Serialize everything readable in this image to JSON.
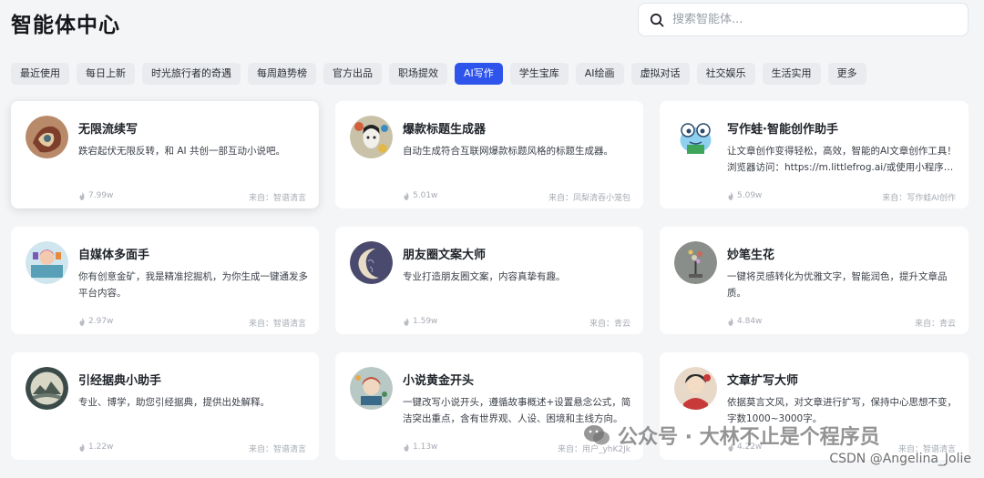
{
  "header": {
    "title": "智能体中心",
    "search_placeholder": "搜索智能体..."
  },
  "tabs": [
    {
      "label": "最近使用"
    },
    {
      "label": "每日上新"
    },
    {
      "label": "时光旅行者的奇遇"
    },
    {
      "label": "每周趋势榜"
    },
    {
      "label": "官方出品"
    },
    {
      "label": "职场提效"
    },
    {
      "label": "AI写作",
      "active": true
    },
    {
      "label": "学生宝库"
    },
    {
      "label": "AI绘画"
    },
    {
      "label": "虚拟对话"
    },
    {
      "label": "社交娱乐"
    },
    {
      "label": "生活实用"
    },
    {
      "label": "更多"
    }
  ],
  "cards": [
    {
      "title": "无限流续写",
      "desc": "跌宕起伏无限反转，和 AI 共创一部互动小说吧。",
      "heat": "7.99w",
      "source": "来自：智谱清言"
    },
    {
      "title": "爆款标题生成器",
      "desc": "自动生成符合互联网爆款标题风格的标题生成器。",
      "heat": "5.01w",
      "source": "来自：凤梨清吞小笼包"
    },
    {
      "title": "写作蛙·智能创作助手",
      "desc": "让文章创作变得轻松，高效，智能的AI文章创作工具！浏览器访问：https://m.littlefrog.ai/或使用小程序…",
      "heat": "5.09w",
      "source": "来自：写作蛙AI创作"
    },
    {
      "title": "自媒体多面手",
      "desc": "你有创意金矿，我是精准挖掘机，为你生成一键通发多平台内容。",
      "heat": "2.97w",
      "source": "来自：智谱清言"
    },
    {
      "title": "朋友圈文案大师",
      "desc": "专业打造朋友圈文案，内容真挚有趣。",
      "heat": "1.59w",
      "source": "来自：青云"
    },
    {
      "title": "妙笔生花",
      "desc": "一键将灵感转化为优雅文字，智能润色，提升文章品质。",
      "heat": "4.84w",
      "source": "来自：青云"
    },
    {
      "title": "引经据典小助手",
      "desc": "专业、博学，助您引经据典，提供出处解释。",
      "heat": "1.22w",
      "source": "来自：智谱清言"
    },
    {
      "title": "小说黄金开头",
      "desc": "一键改写小说开头，遵循故事概述+设置悬念公式，简洁突出重点，含有世界观、人设、困境和主线方向。",
      "heat": "1.13w",
      "source": "来自：用户_yhK2Jk"
    },
    {
      "title": "文章扩写大师",
      "desc": "依据莫言文风，对文章进行扩写，保持中心思想不变，字数1000~3000字。",
      "heat": "4.22w",
      "source": "来自：智谱清言"
    }
  ],
  "overlay": {
    "watermark": "公众号 · 大林不止是个程序员",
    "credit": "CSDN @Angelina_Jolie"
  },
  "colors": {
    "accent": "#2f54eb",
    "background": "#f4f5f7"
  }
}
